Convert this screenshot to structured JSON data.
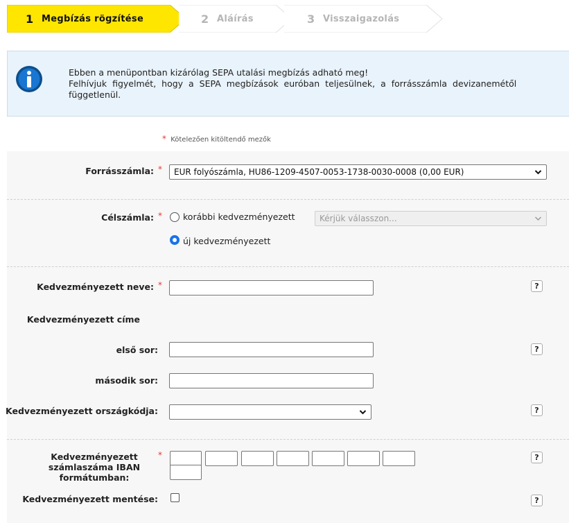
{
  "steps": [
    {
      "number": "1",
      "label": "Megbízás rögzítése",
      "active": true
    },
    {
      "number": "2",
      "label": "Aláírás",
      "active": false
    },
    {
      "number": "3",
      "label": "Visszaigazolás",
      "active": false
    }
  ],
  "info": {
    "icon": "info-icon",
    "line1": "Ebben a menüpontban kizárólag SEPA utalási megbízás adható meg!",
    "line2": "Felhívjuk figyelmét, hogy a SEPA megbízások euróban teljesülnek, a forrásszámla devizanemétől",
    "line3": "függetlenül."
  },
  "required_note": {
    "star": "*",
    "text": "Kötelezően kitöltendő mezők"
  },
  "form": {
    "source_account": {
      "label": "Forrásszámla:",
      "star": "*",
      "selected": "EUR folyószámla, HU86-1209-4507-0053-1738-0030-0008 (0,00 EUR)"
    },
    "target_account": {
      "label": "Célszámla:",
      "star": "*",
      "option_previous": "korábbi kedvezményezett",
      "option_new": "új kedvezményezett",
      "selected_option": "új kedvezményezett",
      "previous_placeholder": "Kérjük válasszon..."
    },
    "beneficiary_name": {
      "label": "Kedvezményezett neve:",
      "star": "*",
      "value": "",
      "help": "?"
    },
    "beneficiary_address": {
      "label": "Kedvezményezett címe"
    },
    "address_line1": {
      "label": "első sor:",
      "value": "",
      "help": "?"
    },
    "address_line2": {
      "label": "második sor:",
      "value": ""
    },
    "country_code": {
      "label": "Kedvezményezett országkódja:",
      "selected": "",
      "help": "?"
    },
    "iban": {
      "label_line1": "Kedvezményezett",
      "label_line2": "számlaszáma IBAN",
      "label_line3": "formátumban:",
      "star": "*",
      "segments": [
        "",
        "",
        "",
        "",
        "",
        "",
        "",
        ""
      ],
      "help": "?"
    },
    "save_beneficiary": {
      "label": "Kedvezményezett mentése:",
      "checked": false,
      "help": "?"
    }
  },
  "colors": {
    "active_step": "#ffe600",
    "inactive_step": "#ffffff",
    "required": "#e53935",
    "info_bg": "#e9f3fb",
    "info_icon": "#1565c0"
  }
}
